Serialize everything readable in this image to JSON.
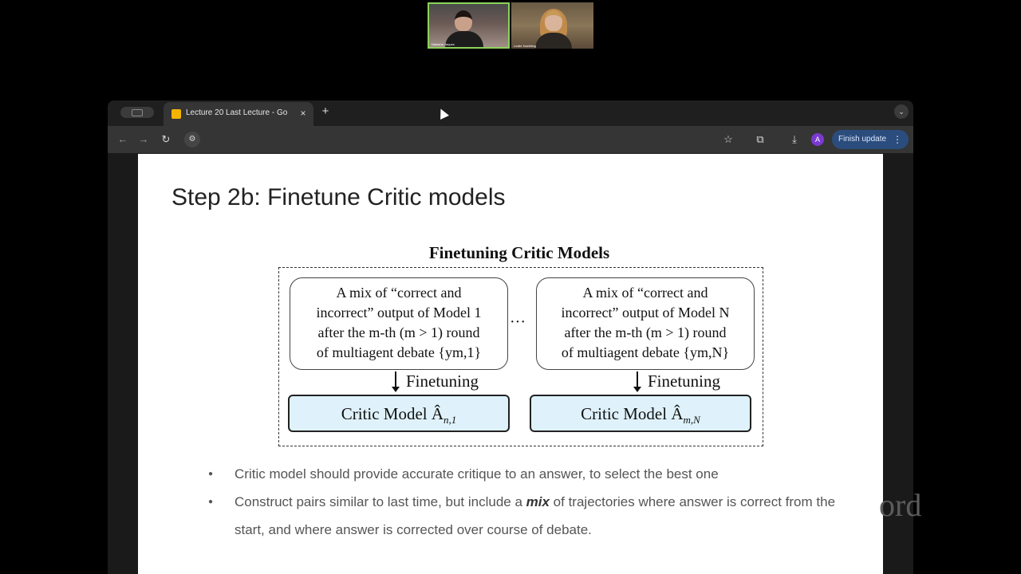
{
  "call": {
    "participants": [
      {
        "name": "Natasha Jaques"
      },
      {
        "name": "Leslie Kaelbling"
      }
    ]
  },
  "browser": {
    "tab_title": "Lecture 20 Last Lecture - Go",
    "tab_close": "×",
    "new_tab": "+",
    "tab_menu": "⌄",
    "toolbar": {
      "back": "←",
      "forward": "→",
      "reload": "↻",
      "site_info": "⚙",
      "bookmark": "☆",
      "extensions": "⧉",
      "download": "⤓",
      "avatar_letter": "A",
      "finish_update": "Finish update",
      "menu": "⋮"
    }
  },
  "slide": {
    "title": "Step 2b: Finetune Critic models",
    "figure": {
      "title": "Finetuning Critic Models",
      "left_box": {
        "line1": "A mix of “correct and",
        "line2": "incorrect” output of Model 1",
        "line3": "after the m-th (m > 1) round",
        "line4": "of multiagent debate {ym,1}"
      },
      "right_box": {
        "line1": "A mix of “correct and",
        "line2": "incorrect” output of Model N",
        "line3": "after the m-th (m > 1) round",
        "line4": "of multiagent debate {ym,N}"
      },
      "ellipsis": "···",
      "finetuning_label": "Finetuning",
      "critic_left": "Critic Model Â",
      "critic_left_sub": "n,1",
      "critic_right": "Critic Model Â",
      "critic_right_sub": "m,N"
    },
    "bullets": [
      {
        "text": "Critic model should provide accurate critique to an answer, to select the best one"
      },
      {
        "pre": "Construct pairs similar to last time, but include a ",
        "em": "mix",
        "post": " of trajectories where answer is correct from the start, and where answer is corrected over course of debate."
      }
    ]
  },
  "watermark": "ord",
  "colors": {
    "slide_bg": "#ffffff",
    "critic_fill": "#dff2fb",
    "finish_update_bg": "#2b4d7d",
    "avatar_bg": "#7a3ad0",
    "speaker_highlight": "#8bd35a"
  }
}
